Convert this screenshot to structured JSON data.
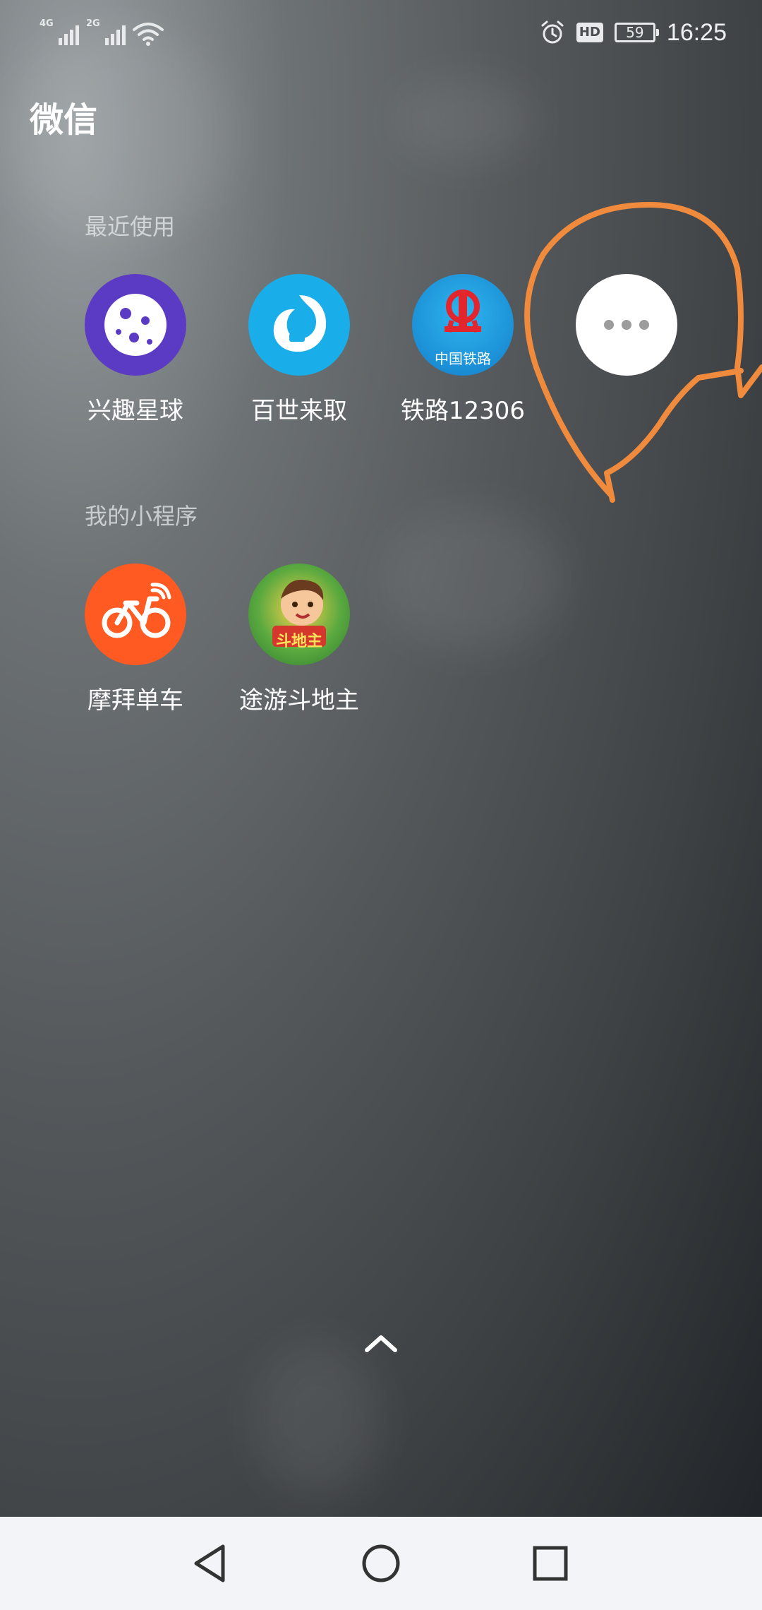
{
  "status_bar": {
    "network1": "4G",
    "network2": "2G",
    "hd": "HD",
    "battery": "59",
    "time": "16:25"
  },
  "app_title": "微信",
  "sections": {
    "recent_label": "最近使用",
    "mine_label": "我的小程序"
  },
  "recent_apps": [
    {
      "label": "兴趣星球",
      "icon": "planet-icon",
      "color": "#5c3bc4"
    },
    {
      "label": "百世来取",
      "icon": "courier-icon",
      "color": "#19aee9"
    },
    {
      "label": "铁路12306",
      "icon": "china-railway-icon",
      "color": "#1b8fd6"
    },
    {
      "label": "",
      "icon": "more-dots-icon",
      "color": "#ffffff"
    }
  ],
  "railway_icon_text": "中国铁路",
  "my_apps": [
    {
      "label": "摩拜单车",
      "icon": "bike-icon",
      "color": "#ff5a21"
    },
    {
      "label": "途游斗地主",
      "icon": "landlord-game-icon",
      "color": "#5aa940"
    }
  ],
  "game_icon_text": "斗地主",
  "annotation_color": "#f08a3c",
  "nav": {
    "back": "back-triangle-icon",
    "home": "home-circle-icon",
    "recents": "recents-square-icon"
  }
}
